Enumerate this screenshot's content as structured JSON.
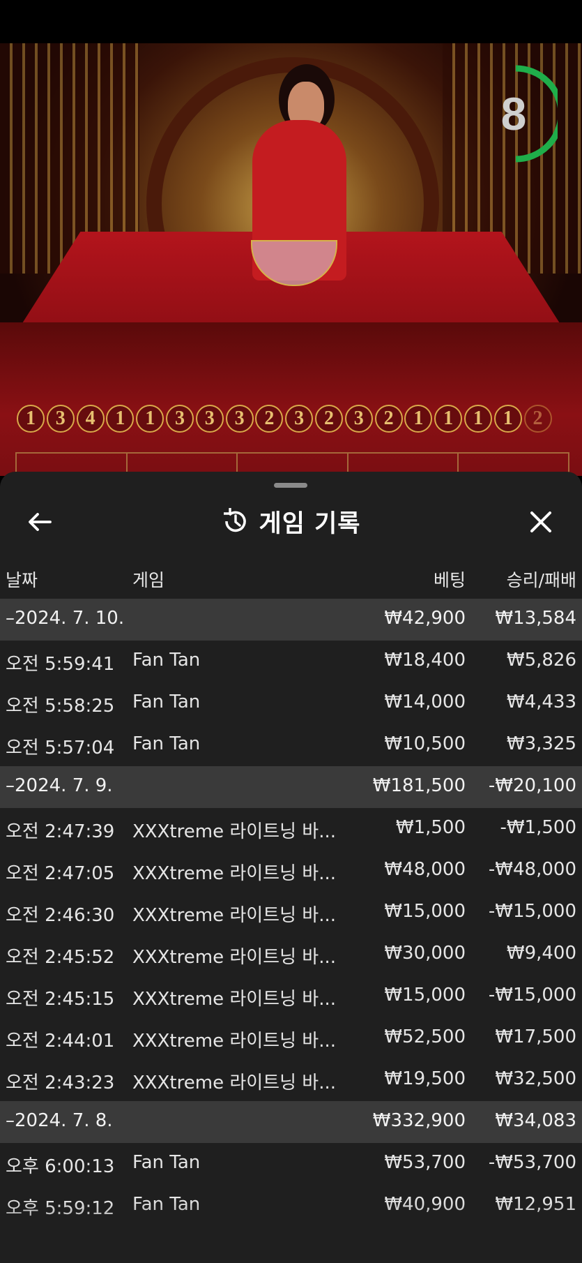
{
  "game_view": {
    "timer_value": "8",
    "road_results": [
      "1",
      "3",
      "4",
      "1",
      "1",
      "3",
      "3",
      "3",
      "2",
      "3",
      "2",
      "3",
      "2",
      "1",
      "1",
      "1",
      "1",
      "2"
    ]
  },
  "history": {
    "title": "게임 기록",
    "columns": {
      "date": "날짜",
      "game": "게임",
      "bet": "베팅",
      "result": "승리/패배"
    },
    "rows": [
      {
        "type": "group",
        "date": "–2024. 7. 10.",
        "game": "",
        "bet": "₩42,900",
        "result": "₩13,584"
      },
      {
        "type": "item",
        "date": "오전 5:59:41",
        "game": "Fan Tan",
        "bet": "₩18,400",
        "result": "₩5,826"
      },
      {
        "type": "item",
        "date": "오전 5:58:25",
        "game": "Fan Tan",
        "bet": "₩14,000",
        "result": "₩4,433"
      },
      {
        "type": "item",
        "date": "오전 5:57:04",
        "game": "Fan Tan",
        "bet": "₩10,500",
        "result": "₩3,325"
      },
      {
        "type": "group",
        "date": "–2024. 7. 9.",
        "game": "",
        "bet": "₩181,500",
        "result": "-₩20,100"
      },
      {
        "type": "item",
        "date": "오전 2:47:39",
        "game": "XXXtreme 라이트닝 바...",
        "bet": "₩1,500",
        "result": "-₩1,500"
      },
      {
        "type": "item",
        "date": "오전 2:47:05",
        "game": "XXXtreme 라이트닝 바...",
        "bet": "₩48,000",
        "result": "-₩48,000"
      },
      {
        "type": "item",
        "date": "오전 2:46:30",
        "game": "XXXtreme 라이트닝 바...",
        "bet": "₩15,000",
        "result": "-₩15,000"
      },
      {
        "type": "item",
        "date": "오전 2:45:52",
        "game": "XXXtreme 라이트닝 바...",
        "bet": "₩30,000",
        "result": "₩9,400"
      },
      {
        "type": "item",
        "date": "오전 2:45:15",
        "game": "XXXtreme 라이트닝 바...",
        "bet": "₩15,000",
        "result": "-₩15,000"
      },
      {
        "type": "item",
        "date": "오전 2:44:01",
        "game": "XXXtreme 라이트닝 바...",
        "bet": "₩52,500",
        "result": "₩17,500"
      },
      {
        "type": "item",
        "date": "오전 2:43:23",
        "game": "XXXtreme 라이트닝 바...",
        "bet": "₩19,500",
        "result": "₩32,500"
      },
      {
        "type": "group",
        "date": "–2024. 7. 8.",
        "game": "",
        "bet": "₩332,900",
        "result": "₩34,083"
      },
      {
        "type": "item",
        "date": "오후 6:00:13",
        "game": "Fan Tan",
        "bet": "₩53,700",
        "result": "-₩53,700"
      },
      {
        "type": "item",
        "date": "오후 5:59:12",
        "game": "Fan Tan",
        "bet": "₩40,900",
        "result": "₩12,951"
      }
    ]
  },
  "icons": {
    "back": "arrow-left-icon",
    "history": "history-icon",
    "close": "close-icon"
  },
  "colors": {
    "panel_bg": "#1f1f1f",
    "group_row_bg": "#3a3a3a",
    "timer_green": "#1fae4a",
    "road_gold": "#d9a94a"
  }
}
